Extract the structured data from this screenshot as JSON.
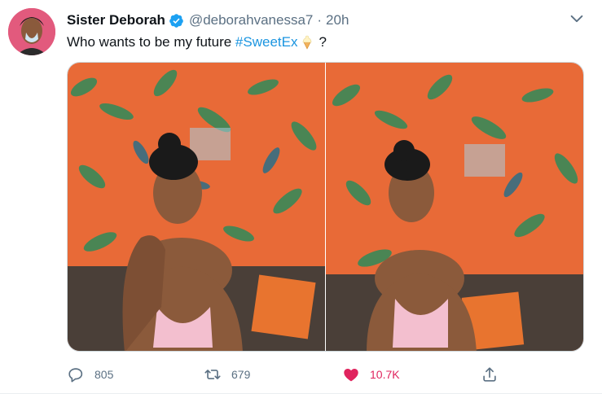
{
  "tweet": {
    "author": {
      "display_name": "Sister Deborah",
      "handle": "@deborahvanessa7",
      "time": "20h",
      "separator": "·",
      "verified": true
    },
    "text": {
      "before": "Who wants to be my future ",
      "hashtag": "#SweetEx",
      "emoji": "soft-ice-cream",
      "after": "?"
    },
    "media": [
      {
        "kind": "photo",
        "scene": "woman-posing-hand-under-chin"
      },
      {
        "kind": "photo",
        "scene": "woman-posing-head-tilted"
      }
    ],
    "actions": {
      "reply_count": "805",
      "retweet_count": "679",
      "like_count": "10.7K",
      "liked": true
    },
    "colors": {
      "accent": "#1b95e0",
      "like": "#e0245e",
      "muted": "#5b7083",
      "verified": "#1da1f2"
    }
  }
}
